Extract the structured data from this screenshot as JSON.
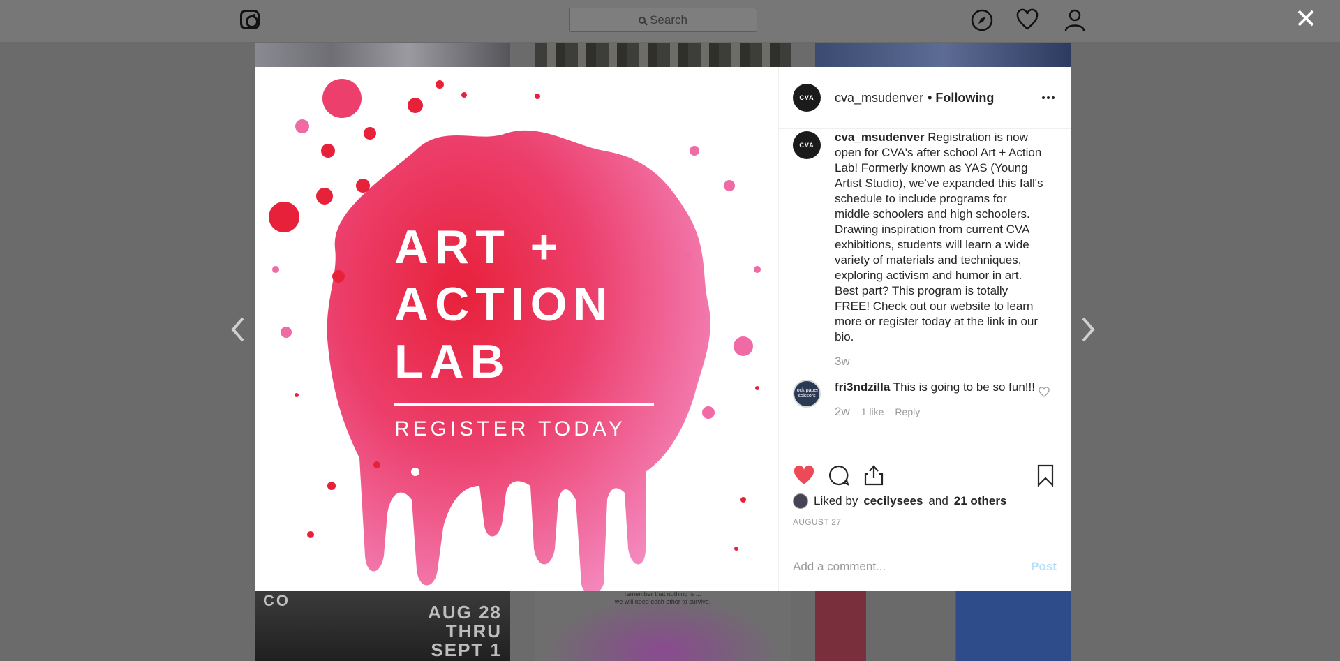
{
  "topbar": {
    "search_placeholder": "Search"
  },
  "thumbs": {
    "bottom_left_word": "CO",
    "bottom_left_dates": [
      "AUG 28",
      "THRU",
      "SEPT 1"
    ],
    "bottom_mid_line1": "remember that nothing is ...",
    "bottom_mid_line2": "we will need each other to survive."
  },
  "post": {
    "username": "cva_msudenver",
    "following_label": "• Following",
    "avatar_text": "CVA",
    "caption": "Registration is now open for CVA's after school Art + Action Lab! Formerly known as YAS (Young Artist Studio), we've expanded this fall's schedule to include programs for middle schoolers and high schoolers. Drawing inspiration from current CVA exhibitions, students will learn a wide variety of materials and techniques, exploring activism and humor in art. Best part? This program is totally FREE! Check out our website to learn more or register today at the link in our bio.",
    "caption_age": "3w",
    "artwork": {
      "line1": "ART +",
      "line2": "ACTION",
      "line3": "LAB",
      "subtitle": "REGISTER TODAY"
    }
  },
  "comments": [
    {
      "username": "fri3ndzilla",
      "text": "This is going to be so fun!!!",
      "age": "2w",
      "likes": "1 like",
      "reply_label": "Reply",
      "avatar_text": "rock paper scissors"
    }
  ],
  "likes": {
    "prefix": "Liked by",
    "first_user": "cecilysees",
    "and_label": "and",
    "others": "21 others"
  },
  "date": "AUGUST 27",
  "add_comment": {
    "placeholder": "Add a comment...",
    "post_label": "Post"
  },
  "colors": {
    "heart_red": "#ed4956",
    "post_disabled": "#b2dffc",
    "splash_red": "#e8213a",
    "splash_pink": "#f06aa6"
  }
}
